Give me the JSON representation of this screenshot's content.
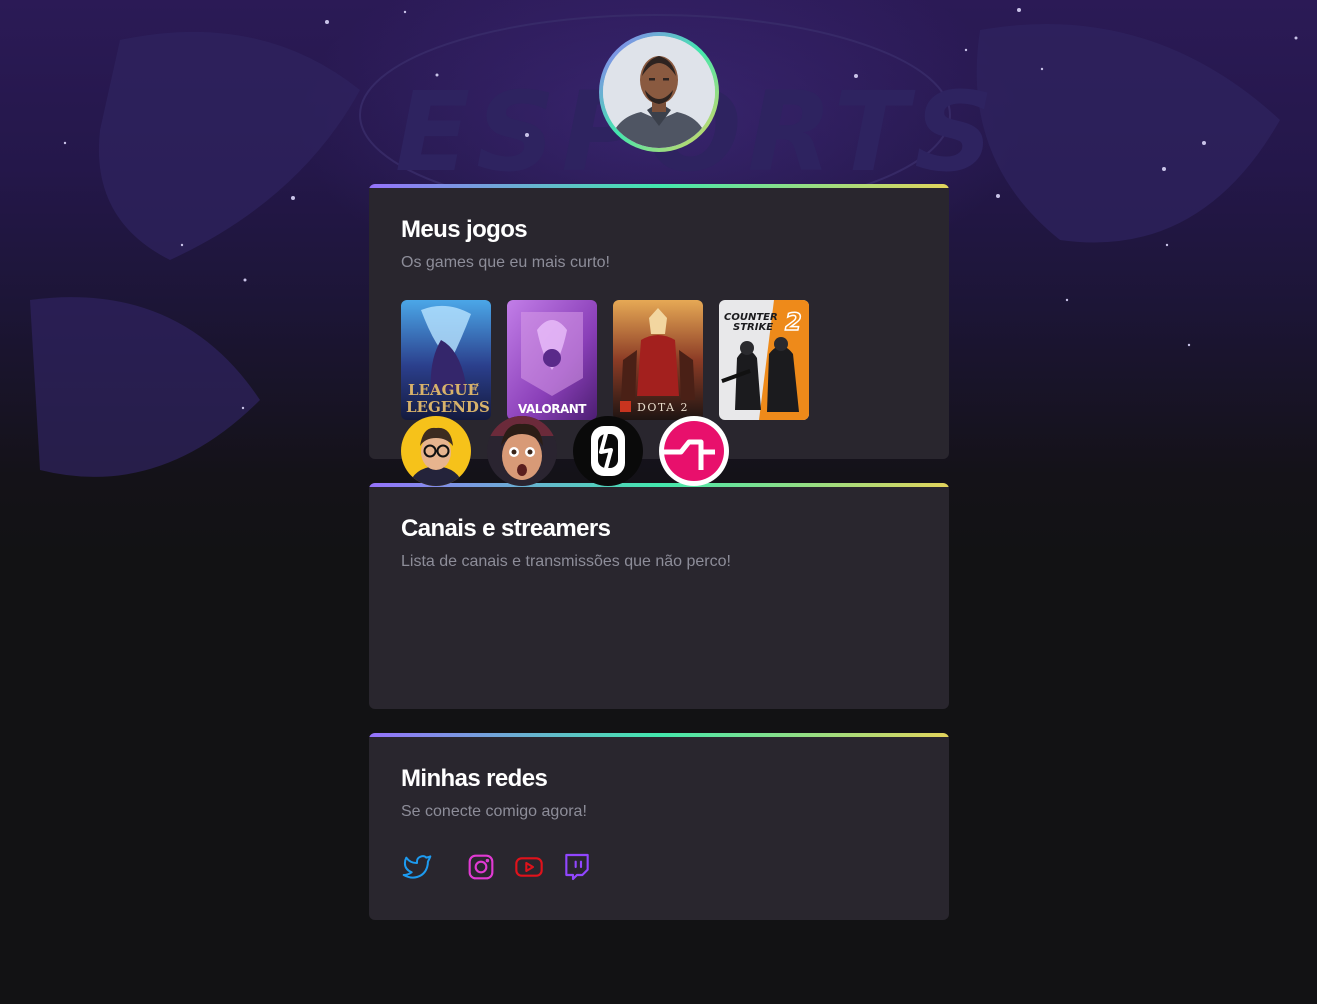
{
  "profile": {
    "avatar_icon": "profile-photo"
  },
  "games_card": {
    "title": "Meus jogos",
    "subtitle": "Os games que eu mais curto!",
    "games": [
      {
        "logo_line1": "LEAGUE",
        "logo_of": "OF",
        "logo_line2": "LEGENDS"
      },
      {
        "logo": "VALORANT"
      },
      {
        "logo": "DOTA 2"
      },
      {
        "logo_line1": "COUNTER",
        "logo_line2": "STRIKE",
        "logo_num": "2"
      }
    ]
  },
  "streamers_card": {
    "title": "Canais e streamers",
    "subtitle": "Lista de canais e transmissões que não perco!"
  },
  "social_card": {
    "title": "Minhas redes",
    "subtitle": "Se conecte comigo agora!",
    "icons": [
      "twitter-icon",
      "instagram-icon",
      "youtube-icon",
      "twitch-icon"
    ]
  },
  "colors": {
    "gradient_start": "#9572fc",
    "gradient_mid": "#43e7ad",
    "gradient_end": "#e2d45c",
    "card_bg": "#29262e",
    "page_bg": "#121214"
  }
}
